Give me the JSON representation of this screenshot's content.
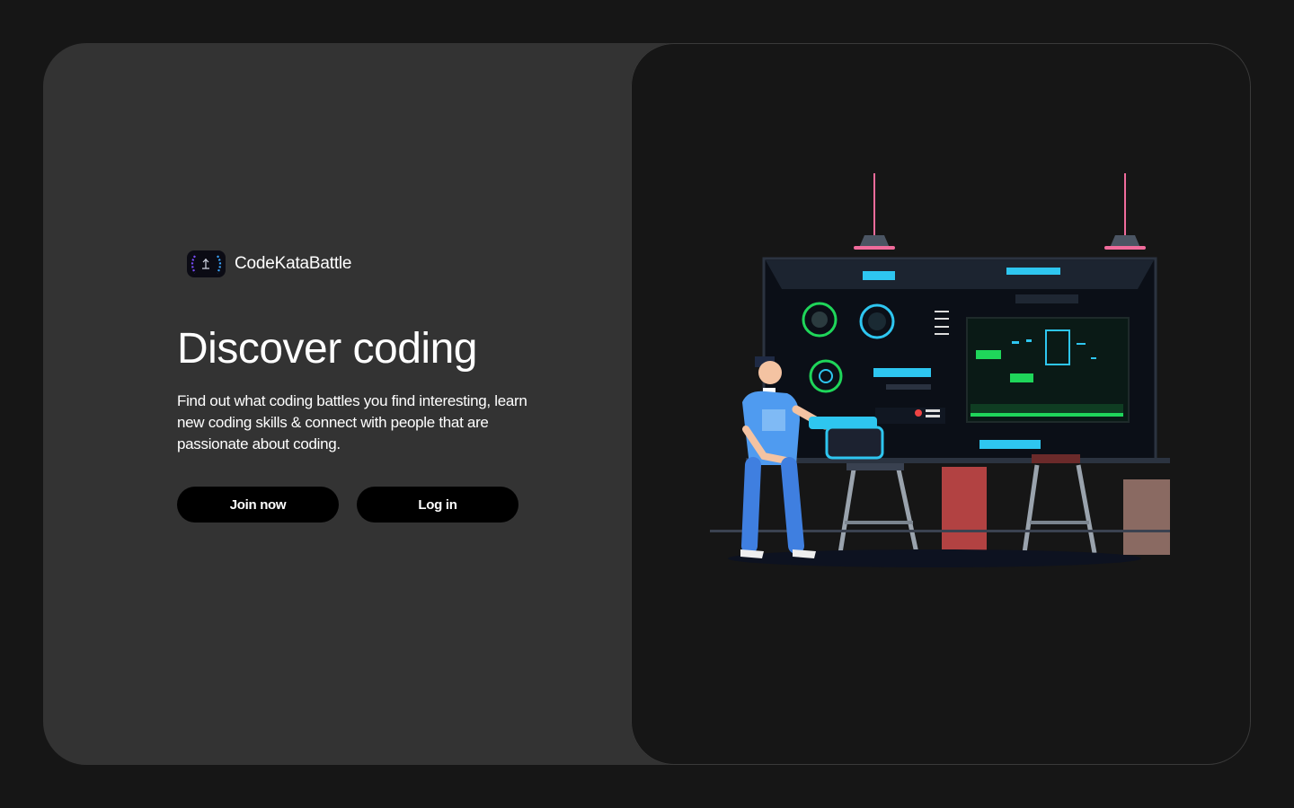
{
  "brand": {
    "name": "CodeKataBattle",
    "logo_icon": "laurel-hand-logo-icon"
  },
  "hero": {
    "title": "Discover coding",
    "description": "Find out what coding battles you find interesting, learn new coding skills & connect with people that are passionate about coding."
  },
  "actions": {
    "join_label": "Join now",
    "login_label": "Log in"
  },
  "illustration": {
    "subject": "developer-at-monitor-wall-illustration"
  },
  "colors": {
    "page_background": "#161616",
    "card_background": "#333333",
    "panel_background": "#161616",
    "button_background": "#000000",
    "text": "#ffffff",
    "accent_cyan": "#2ec6f0",
    "accent_green": "#1fd65a",
    "lamp_pink": "#f06b9b"
  }
}
